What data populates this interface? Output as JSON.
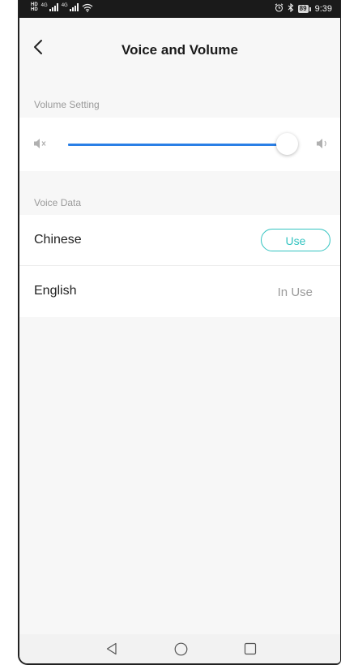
{
  "status_bar": {
    "hd_top": "HD",
    "hd_bottom": "HD",
    "signal1_label": "4G",
    "signal2_label": "4G",
    "battery_level": "89",
    "time": "9:39"
  },
  "header": {
    "title": "Voice and Volume"
  },
  "volume_section": {
    "label": "Volume Setting",
    "volume_level": 1.0,
    "accent_color": "#2a7fe6"
  },
  "voice_section": {
    "label": "Voice Data",
    "items": [
      {
        "name": "Chinese",
        "action_label": "Use"
      },
      {
        "name": "English",
        "status_label": "In Use"
      }
    ],
    "use_color": "#32c3c0"
  },
  "icons": {
    "back": "chevron-left-icon",
    "mute": "speaker-mute-icon",
    "volume": "speaker-volume-icon",
    "nav_back": "triangle-back-icon",
    "nav_home": "circle-home-icon",
    "nav_recent": "square-recent-icon"
  }
}
